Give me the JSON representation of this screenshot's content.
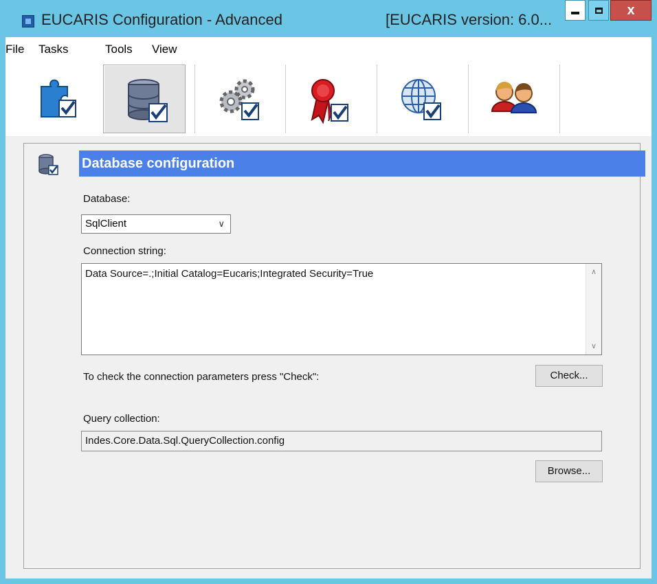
{
  "window": {
    "title": "EUCARIS Configuration - Advanced",
    "version": "[EUCARIS version: 6.0...",
    "close_label": "x"
  },
  "menu": [
    "File",
    "Tasks",
    "Tools",
    "View"
  ],
  "toolbar": {
    "items": [
      {
        "icon": "puzzle-check-icon",
        "selected": false
      },
      {
        "icon": "database-check-icon",
        "selected": true
      },
      {
        "icon": "gears-check-icon",
        "selected": false
      },
      {
        "icon": "certificate-ribbon-check-icon",
        "selected": false
      },
      {
        "icon": "globe-check-icon",
        "selected": false
      },
      {
        "icon": "users-icon",
        "selected": false
      }
    ]
  },
  "section": {
    "title": "Database configuration",
    "icon": "database-check-icon"
  },
  "database": {
    "label": "Database:",
    "value": "SqlClient"
  },
  "connection": {
    "label": "Connection string:",
    "value": "Data Source=.;Initial Catalog=Eucaris;Integrated Security=True"
  },
  "check": {
    "text": "To check the connection parameters press \"Check\":",
    "button": "Check..."
  },
  "query": {
    "label": "Query collection:",
    "value": "Indes.Core.Data.Sql.QueryCollection.config",
    "browse_button": "Browse..."
  },
  "colors": {
    "title_bar": "#6bc6e6",
    "section_header": "#4a80e8",
    "close_button": "#c7504a"
  }
}
